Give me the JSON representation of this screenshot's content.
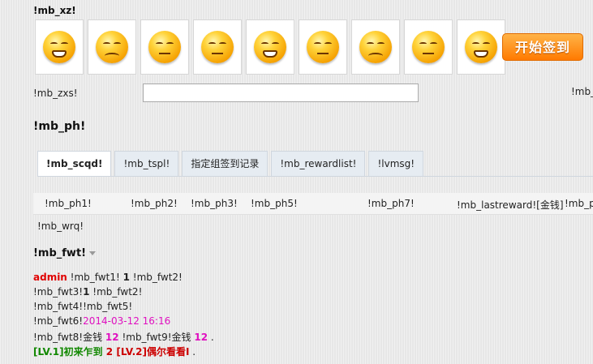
{
  "mood_section": {
    "title": "!mb_xz!"
  },
  "moods": [
    {
      "icon": "grin-icon"
    },
    {
      "icon": "crying-icon"
    },
    {
      "icon": "dizzy-icon"
    },
    {
      "icon": "sleeping-icon"
    },
    {
      "icon": "angry-icon"
    },
    {
      "icon": "sweat-icon"
    },
    {
      "icon": "sigh-icon"
    },
    {
      "icon": "speechless-icon"
    },
    {
      "icon": "tearful-icon"
    }
  ],
  "sign_button": {
    "label": "开始签到"
  },
  "say": {
    "label": "!mb_zxs!",
    "value": "",
    "right_label": "!mb_"
  },
  "ranking": {
    "title": "!mb_ph!"
  },
  "tabs": [
    {
      "label": "!mb_scqd!"
    },
    {
      "label": "!mb_tspl!"
    },
    {
      "label": "指定组签到记录"
    },
    {
      "label": "!mb_rewardlist!"
    },
    {
      "label": "!lvmsg!"
    }
  ],
  "table": {
    "headers": [
      "!mb_ph1!",
      "!mb_ph2!",
      "!mb_ph3!",
      "!mb_ph5!",
      "!mb_ph7!",
      "!mb_lastreward![金钱]",
      "!mb_ph"
    ],
    "empty_text": "!mb_wrq!"
  },
  "stats": {
    "title": "!mb_fwt!",
    "line1": {
      "user": "admin",
      "text1": " !mb_fwt1! ",
      "count": "1",
      "text2": " !mb_fwt2!"
    },
    "line2": {
      "text1": "!mb_fwt3!",
      "count": "1",
      "text2": " !mb_fwt2!"
    },
    "line3": {
      "text": "!mb_fwt4!!mb_fwt5!"
    },
    "line4": {
      "text": "!mb_fwt6!",
      "time": "2014-03-12 16:16"
    },
    "line5": {
      "text1": "!mb_fwt8!金钱 ",
      "v1": "12",
      "text2": " !mb_fwt9!金钱 ",
      "v2": "12",
      "end": " ."
    },
    "line6": {
      "lv1": "[LV.1]初来乍到",
      "count": " 2 ",
      "lv2": "[LV.2]偶尔看看I",
      "end": " ."
    }
  }
}
